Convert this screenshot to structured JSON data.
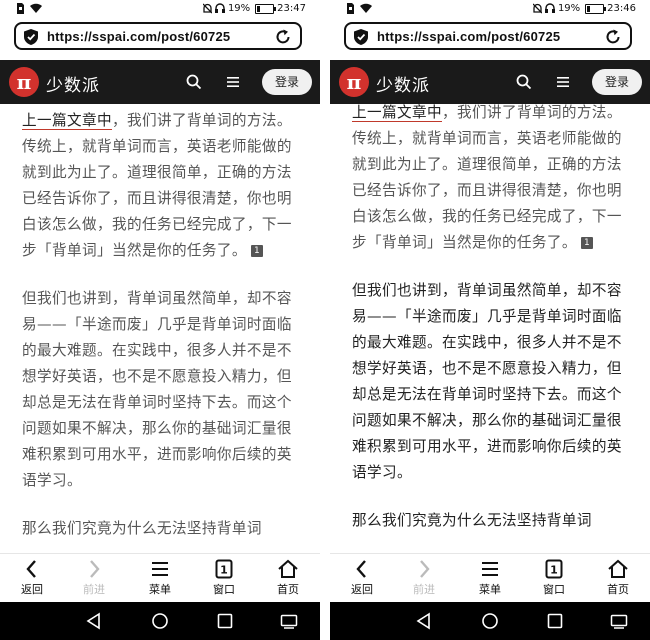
{
  "screens": [
    {
      "status": {
        "battery": "19%",
        "time": "23:47",
        "battery_level": 0.19
      },
      "url": "https://sspai.com/post/60725",
      "site": {
        "logo_char": "π",
        "name": "少数派",
        "login": "登录"
      },
      "article": {
        "para1_link": "上一篇文章中",
        "para1_rest": "，我们讲了背单词的方法。传统上，就背单词而言，英语老师能做的就到此为止了。道理很简单，正确的方法已经告诉你了，而且讲得很清楚，你也明白该怎么做，我的任务已经完成了，下一步「背单词」当然是你的任务了。",
        "footnote": "1",
        "para2": "但我们也讲到，背单词虽然简单，却不容易——「半途而废」几乎是背单词时面临的最大难题。在实践中，很多人并不是不想学好英语，也不是不愿意投入精力，但却总是无法在背单词时坚持下去。而这个问题如果不解决，那么你的基础词汇量很难积累到可用水平，进而影响你后续的英语学习。",
        "para3": "那么我们究竟为什么无法坚持背单词"
      },
      "toolbar": {
        "back": "返回",
        "forward": "前进",
        "menu": "菜单",
        "window": "窗口",
        "window_count": "1",
        "home": "首页"
      }
    },
    {
      "status": {
        "battery": "19%",
        "time": "23:46",
        "battery_level": 0.19
      },
      "url": "https://sspai.com/post/60725",
      "site": {
        "logo_char": "π",
        "name": "少数派",
        "login": "登录"
      },
      "article": {
        "para1_link": "上一篇文章中",
        "para1_rest": "，我们讲了背单词的方法。传统上，就背单词而言，英语老师能做的就到此为止了。道理很简单，正确的方法已经告诉你了，而且讲得很清楚，你也明白该怎么做，我的任务已经完成了，下一步「背单词」当然是你的任务了。",
        "footnote": "1",
        "para2": "但我们也讲到，背单词虽然简单，却不容易——「半途而废」几乎是背单词时面临的最大难题。在实践中，很多人并不是不想学好英语，也不是不愿意投入精力，但却总是无法在背单词时坚持下去。而这个问题如果不解决，那么你的基础词汇量很难积累到可用水平，进而影响你后续的英语学习。",
        "para3": "那么我们究竟为什么无法坚持背单词"
      },
      "toolbar": {
        "back": "返回",
        "forward": "前进",
        "menu": "菜单",
        "window": "窗口",
        "window_count": "1",
        "home": "首页"
      }
    }
  ],
  "colors": {
    "brand_red": "#d2322d",
    "header_bg": "#1a1a1a",
    "text_gray": "#555555",
    "text_dark": "#222222"
  }
}
